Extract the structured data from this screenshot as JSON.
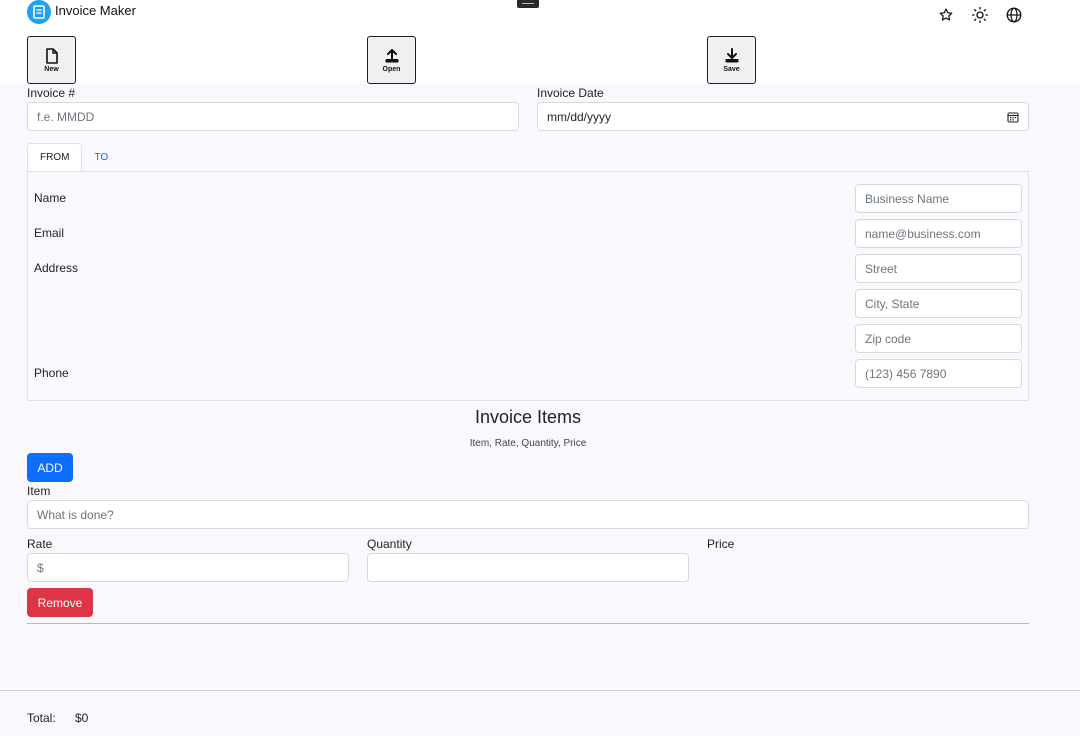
{
  "app": {
    "title": "Invoice Maker"
  },
  "toolbar": {
    "new_label": "New",
    "open_label": "Open",
    "save_label": "Save"
  },
  "invoice": {
    "number_label": "Invoice #",
    "number_placeholder": "f.e. MMDD",
    "date_label": "Invoice Date",
    "date_placeholder": "mm/dd/yyyy"
  },
  "tabs": [
    {
      "label": "FROM",
      "active": true
    },
    {
      "label": "TO",
      "active": false
    }
  ],
  "from": {
    "name_label": "Name",
    "name_placeholder": "Business Name",
    "email_label": "Email",
    "email_placeholder": "name@business.com",
    "address_label": "Address",
    "street_placeholder": "Street",
    "city_placeholder": "City, State",
    "zip_placeholder": "Zip code",
    "phone_label": "Phone",
    "phone_placeholder": "(123) 456 7890"
  },
  "items_section": {
    "title": "Invoice Items",
    "subtitle": "Item, Rate, Quantity, Price",
    "add_label": "ADD",
    "item_label": "Item",
    "item_placeholder": "What is done?",
    "rate_label": "Rate",
    "rate_placeholder": "$",
    "quantity_label": "Quantity",
    "quantity_value": "",
    "price_label": "Price",
    "remove_label": "Remove"
  },
  "footer": {
    "total_label": "Total:",
    "total_value": "$0"
  },
  "colors": {
    "primary": "#0d6efd",
    "danger": "#dc3545",
    "logo": "#1ea1f2",
    "background": "#fbf8fd"
  },
  "icons": [
    "document-icon",
    "star-icon",
    "sun-icon",
    "globe-icon",
    "file-new-icon",
    "upload-icon",
    "download-icon",
    "calendar-icon"
  ]
}
